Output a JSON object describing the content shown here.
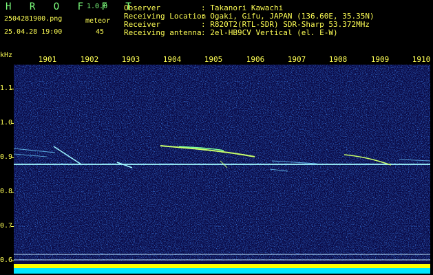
{
  "header": {
    "app_title": "H R O F F T",
    "version": "1.0.0",
    "filename": "2504281900.png",
    "meteor_label": "meteor",
    "datetime": "25.04.28 19:00",
    "meteor_count": "45",
    "info_labels": [
      "Observer",
      "Receiving Location",
      "Receiver",
      "Receiving antenna"
    ],
    "info_values": [
      ": Takanori Kawachi",
      ": Ogaki, Gifu, JAPAN (136.60E, 35.35N)",
      ": R820T2(RTL-SDR) SDR-Sharp 53.372MHz",
      ": 2el-HB9CV Vertical (el. E-W)"
    ]
  },
  "axes": {
    "y_unit": "kHz",
    "y_ticks": [
      "1.1",
      "1.0",
      "0.9",
      "0.8",
      "0.7",
      "0.6"
    ],
    "x_ticks": [
      "1901",
      "1902",
      "1903",
      "1904",
      "1905",
      "1906",
      "1907",
      "1908",
      "1909",
      "1910"
    ]
  },
  "colors": {
    "background": "#000000",
    "plot_background": "#0a0a46",
    "axis_text": "#ffff55",
    "header_text": "#7dff7d",
    "carrier_line": "#9ff7ff",
    "meteor_trail": "#c8ff6a",
    "baseline_bar_yellow": "#ffff00",
    "baseline_bar_cyan": "#00e5ff"
  }
}
